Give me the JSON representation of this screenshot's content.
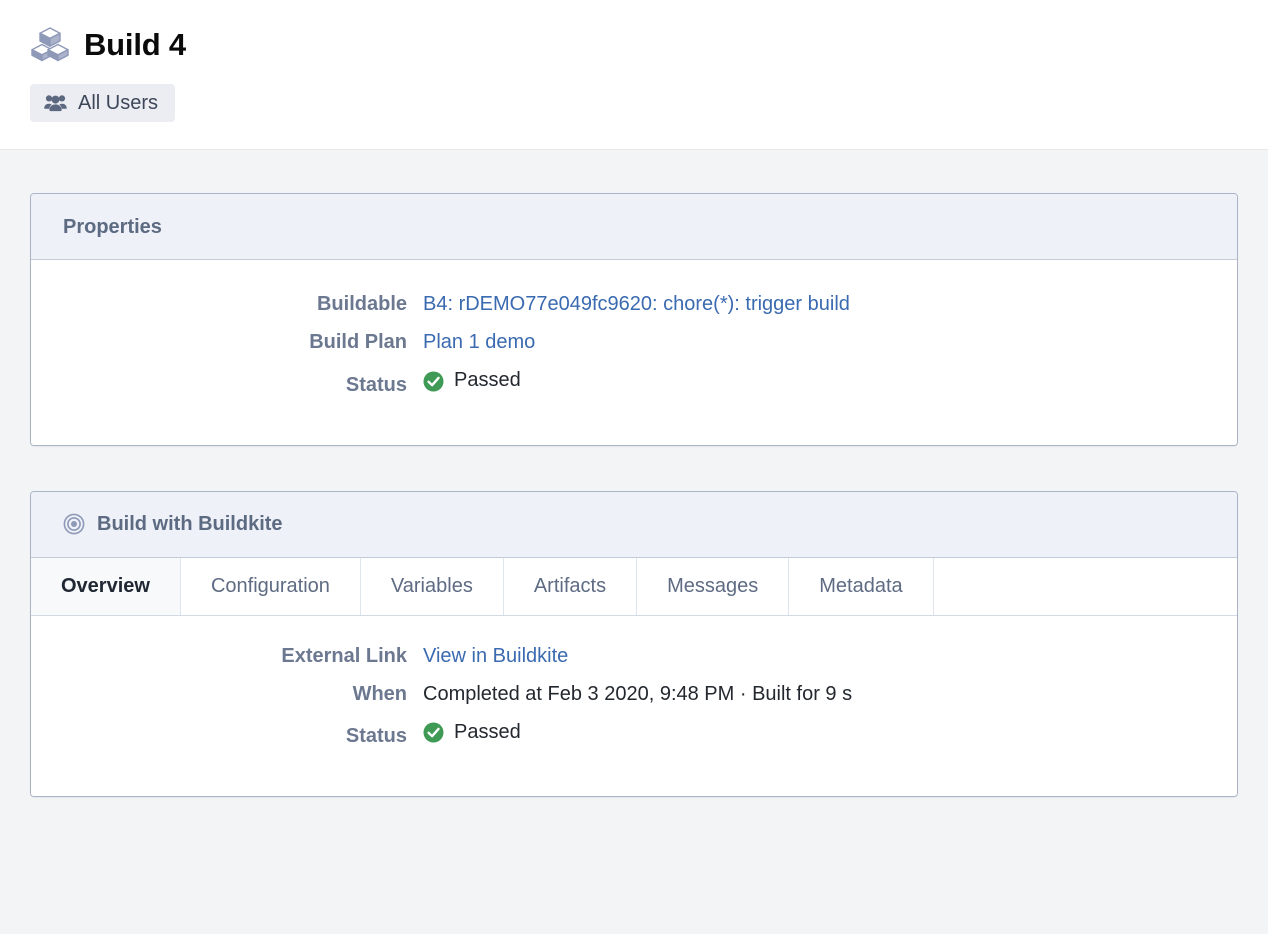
{
  "header": {
    "icon": "cubes-icon",
    "title": "Build 4",
    "tag": {
      "icon": "users-icon",
      "label": "All Users"
    }
  },
  "colors": {
    "page_background": "#f3f4f6",
    "panel_header_background": "#eff1f8",
    "panel_border": "#a9b5c6",
    "link": "#3a6ab0",
    "label": "#6b7890",
    "panel_title": "#5c6a82",
    "status_passed": "#3f9a55",
    "icon_muted": "#8e99b8",
    "tag_background": "#ebedf2"
  },
  "panels": [
    {
      "id": "properties",
      "title": "Properties",
      "icon": null,
      "rows": [
        {
          "label": "Buildable",
          "value": "B4: rDEMO77e049fc9620: chore(*): trigger build",
          "type": "link"
        },
        {
          "label": "Build Plan",
          "value": "Plan 1 demo",
          "type": "link"
        },
        {
          "label": "Status",
          "value": "Passed",
          "type": "status",
          "status_icon": "check-circle-icon"
        }
      ]
    },
    {
      "id": "build-with-buildkite",
      "title": "Build with Buildkite",
      "icon": "target-icon",
      "tabs": [
        {
          "label": "Overview",
          "active": true
        },
        {
          "label": "Configuration",
          "active": false
        },
        {
          "label": "Variables",
          "active": false
        },
        {
          "label": "Artifacts",
          "active": false
        },
        {
          "label": "Messages",
          "active": false
        },
        {
          "label": "Metadata",
          "active": false
        }
      ],
      "rows": [
        {
          "label": "External Link",
          "value": "View in Buildkite",
          "type": "link"
        },
        {
          "label": "When",
          "value": "Completed at Feb 3 2020, 9:48 PM · Built for 9 s",
          "type": "text"
        },
        {
          "label": "Status",
          "value": "Passed",
          "type": "status",
          "status_icon": "check-circle-icon"
        }
      ]
    }
  ]
}
